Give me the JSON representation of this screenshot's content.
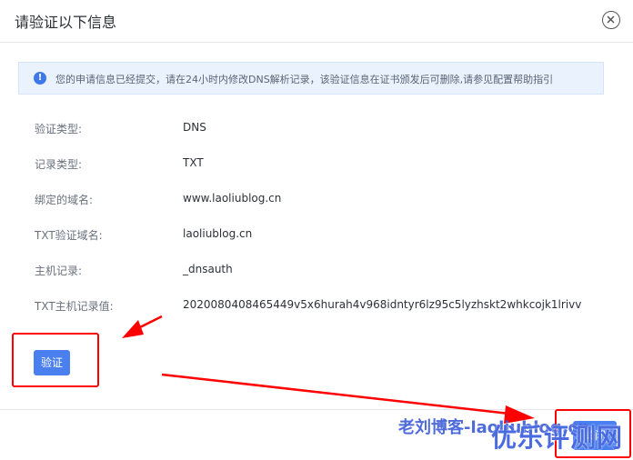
{
  "dialog": {
    "title": "请验证以下信息",
    "close_icon": "close-circle-icon"
  },
  "notice": {
    "icon": "info-circle-icon",
    "text": "您的申请信息已经提交，请在24小时内修改DNS解析记录，该验证信息在证书颁发后可删除,请参见配置帮助指引"
  },
  "details": [
    {
      "label": "验证类型:",
      "value": "DNS"
    },
    {
      "label": "记录类型:",
      "value": "TXT"
    },
    {
      "label": "绑定的域名:",
      "value": "www.laoliublog.cn"
    },
    {
      "label": "TXT验证域名:",
      "value": "laoliublog.cn"
    },
    {
      "label": "主机记录:",
      "value": "_dnsauth"
    },
    {
      "label": "TXT主机记录值:",
      "value": "2020080408465449v5x6hurah4v968idntyr6lz95c5lyzhskt2whkcojk1lrivv"
    }
  ],
  "buttons": {
    "verify": "验证",
    "close": "关闭"
  },
  "watermarks": {
    "blog": "老刘博客-laoliublog.cn",
    "site": "优乐评测网"
  },
  "colors": {
    "accent": "#4a7ff0",
    "annotation": "#ff0000"
  }
}
